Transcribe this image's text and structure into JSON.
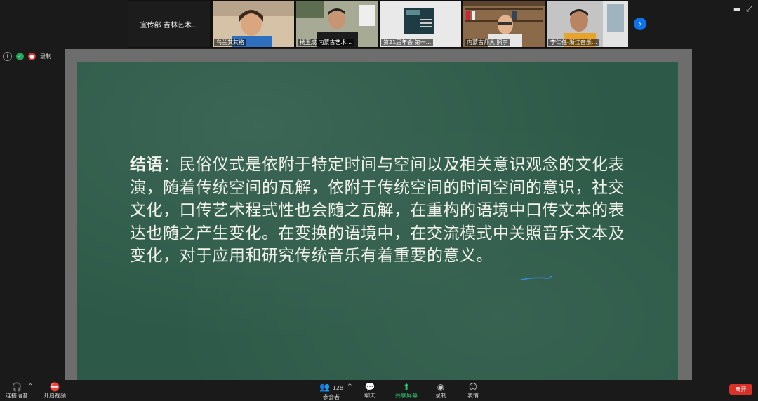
{
  "participants": [
    {
      "type": "text",
      "name": "宣传部 吉林艺术...",
      "label": ""
    },
    {
      "type": "video",
      "label": "乌兰其其格",
      "bg": "#c9b49a"
    },
    {
      "type": "video",
      "label": "杨玉成 内蒙古艺术...",
      "bg": "#9aa08a"
    },
    {
      "type": "video",
      "label": "第21届年会 第一...",
      "bg": "#e6e6e6"
    },
    {
      "type": "video",
      "label": "内蒙古师大 照宇",
      "bg": "#a67c52"
    },
    {
      "type": "video",
      "label": "李仁任-浙江音乐...",
      "bg": "#bfbfbf"
    }
  ],
  "status": {
    "record_label": "录制"
  },
  "slide": {
    "title": "结语",
    "colon": "：",
    "body": "民俗仪式是依附于特定时间与空间以及相关意识观念的文化表演，随着传统空间的瓦解，依附于传统空间的时间空间的意识，社交文化，口传艺术程式性也会随之瓦解，在重构的语境中口传文本的表达也随之产生变化。在变换的语境中，在交流模式中关照音乐文本及变化，对于应用和研究传统音乐有着重要的意义。"
  },
  "toolbar": {
    "audio": "连接语音",
    "video": "开启视频",
    "participants": "参会者",
    "participants_count": "128",
    "chat": "聊天",
    "share": "共享屏幕",
    "record": "录制",
    "reactions": "表情",
    "leave": "离开"
  },
  "colors": {
    "board": "#2d5a48",
    "accent": "#0e72ed",
    "share_green": "#2ecc71",
    "leave": "#d7312a"
  }
}
